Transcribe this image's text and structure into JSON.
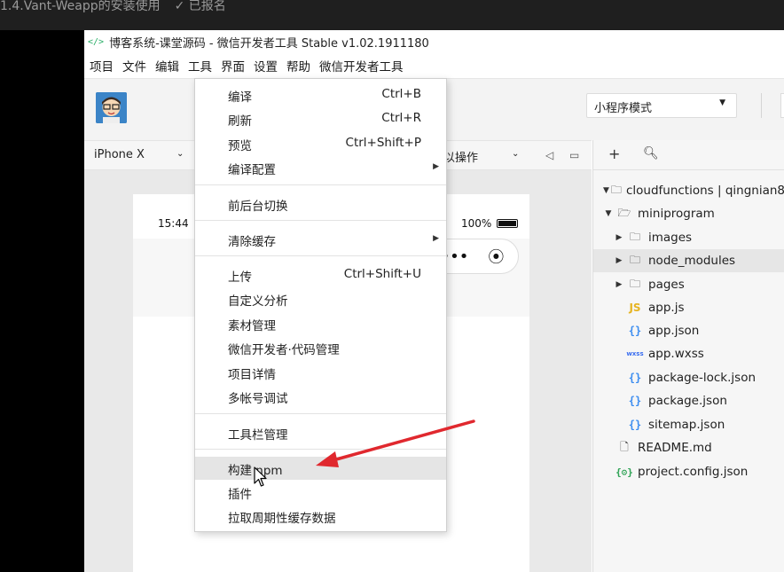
{
  "course": {
    "title": "1.4.Vant-Weapp的安装使用",
    "status": "✓ 已报名"
  },
  "window": {
    "title": "博客系统-课堂源码 - 微信开发者工具 Stable v1.02.1911180"
  },
  "menubar": [
    "项目",
    "文件",
    "编辑",
    "工具",
    "界面",
    "设置",
    "帮助",
    "微信开发者工具"
  ],
  "toolbar": {
    "mode": "小程序模式"
  },
  "simulator": {
    "device": "iPhone X",
    "operation": "以操作",
    "time": "15:44",
    "battery": "100%"
  },
  "tools_menu": [
    {
      "label": "编译",
      "shortcut": "Ctrl+B"
    },
    {
      "label": "刷新",
      "shortcut": "Ctrl+R"
    },
    {
      "label": "预览",
      "shortcut": "Ctrl+Shift+P"
    },
    {
      "label": "编译配置",
      "submenu": true
    },
    {
      "label": "前后台切换"
    },
    {
      "label": "清除缓存",
      "submenu": true
    },
    {
      "label": "上传",
      "shortcut": "Ctrl+Shift+U"
    },
    {
      "label": "自定义分析"
    },
    {
      "label": "素材管理"
    },
    {
      "label": "微信开发者·代码管理"
    },
    {
      "label": "项目详情"
    },
    {
      "label": "多帐号调试"
    },
    {
      "label": "工具栏管理"
    },
    {
      "label": "构建 npm",
      "active": true
    },
    {
      "label": "插件"
    },
    {
      "label": "拉取周期性缓存数据"
    }
  ],
  "file_tree": [
    {
      "name": "cloudfunctions | qingnian8",
      "type": "folder-cloud",
      "expanded": true
    },
    {
      "name": "miniprogram",
      "type": "folder",
      "expanded": true
    },
    {
      "name": "images",
      "type": "folder",
      "expanded": false
    },
    {
      "name": "node_modules",
      "type": "folder",
      "expanded": false,
      "highlighted": true
    },
    {
      "name": "pages",
      "type": "folder",
      "expanded": false
    },
    {
      "name": "app.js",
      "type": "js"
    },
    {
      "name": "app.json",
      "type": "json"
    },
    {
      "name": "app.wxss",
      "type": "wxss"
    },
    {
      "name": "package-lock.json",
      "type": "json"
    },
    {
      "name": "package.json",
      "type": "json"
    },
    {
      "name": "sitemap.json",
      "type": "json"
    },
    {
      "name": "README.md",
      "type": "file"
    },
    {
      "name": "project.config.json",
      "type": "config"
    }
  ],
  "icons": {
    "add": "plus-icon",
    "search": "search-icon"
  },
  "colors": {
    "annotation_arrow": "#e0282e",
    "wechat_green": "#2aae67"
  }
}
